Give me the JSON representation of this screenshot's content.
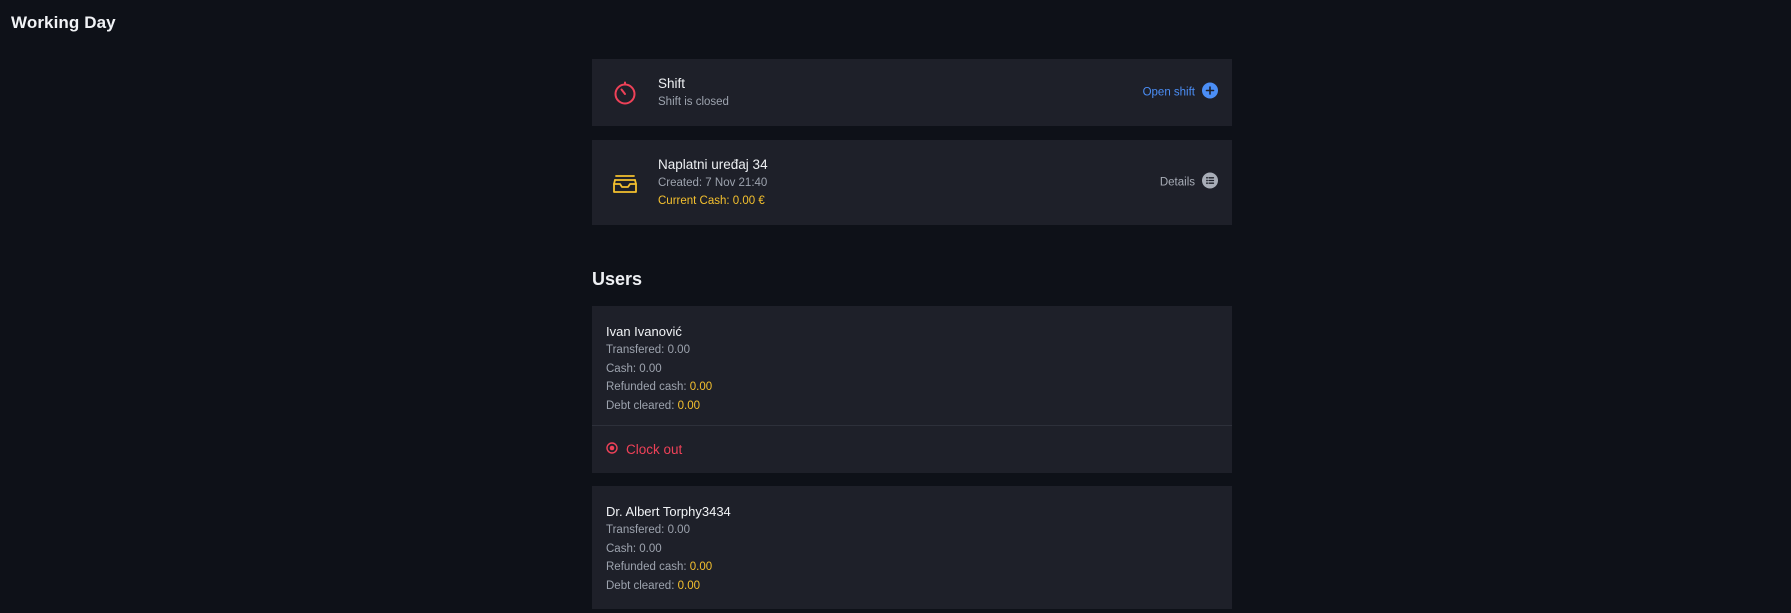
{
  "header": {
    "title": "Working Day"
  },
  "shift": {
    "title": "Shift",
    "status": "Shift is closed",
    "action_label": "Open shift",
    "icon": "timer-icon",
    "icon_color": "#ee4158",
    "action_color": "#4b8ef6"
  },
  "device": {
    "title": "Naplatni uređaj 34",
    "created": "Created: 7 Nov 21:40",
    "current_cash": "Current Cash: 0.00 €",
    "action_label": "Details",
    "icon": "inbox-tray-icon",
    "icon_color": "#f4c02e"
  },
  "users_section": {
    "title": "Users"
  },
  "users": [
    {
      "name": "Ivan Ivanović",
      "transfered_label": "Transfered: ",
      "transfered": "0.00",
      "cash_label": "Cash: ",
      "cash": "0.00",
      "refunded_label": "Refunded cash: ",
      "refunded": "0.00",
      "debt_label": "Debt cleared: ",
      "debt": "0.00",
      "action_label": "Clock out"
    },
    {
      "name": "Dr. Albert Torphy3434",
      "transfered_label": "Transfered: ",
      "transfered": "0.00",
      "cash_label": "Cash: ",
      "cash": "0.00",
      "refunded_label": "Refunded cash: ",
      "refunded": "0.00",
      "debt_label": "Debt cleared: ",
      "debt": "0.00"
    }
  ]
}
